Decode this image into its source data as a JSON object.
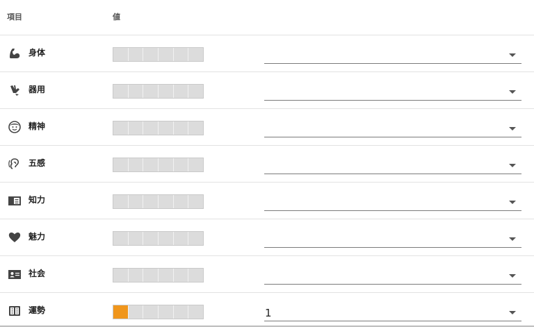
{
  "header": {
    "item_label": "項目",
    "value_label": "値"
  },
  "rows": [
    {
      "key": "body",
      "label": "身体",
      "icon": "flexed-arm-icon",
      "level": 0,
      "max": 6,
      "selected": ""
    },
    {
      "key": "dex",
      "label": "器用",
      "icon": "hand-icon",
      "level": 0,
      "max": 6,
      "selected": ""
    },
    {
      "key": "mind",
      "label": "精神",
      "icon": "face-icon",
      "level": 0,
      "max": 6,
      "selected": ""
    },
    {
      "key": "sense",
      "label": "五感",
      "icon": "ear-icon",
      "level": 0,
      "max": 6,
      "selected": ""
    },
    {
      "key": "intel",
      "label": "知力",
      "icon": "book-icon",
      "level": 0,
      "max": 6,
      "selected": ""
    },
    {
      "key": "charm",
      "label": "魅力",
      "icon": "heart-icon",
      "level": 0,
      "max": 6,
      "selected": ""
    },
    {
      "key": "social",
      "label": "社会",
      "icon": "id-card-icon",
      "level": 0,
      "max": 6,
      "selected": ""
    },
    {
      "key": "luck",
      "label": "運勢",
      "icon": "dice-icon",
      "level": 1,
      "max": 6,
      "selected": "1"
    }
  ],
  "colors": {
    "meter_on": "#f0961c",
    "meter_off": "#dcdcdc"
  }
}
